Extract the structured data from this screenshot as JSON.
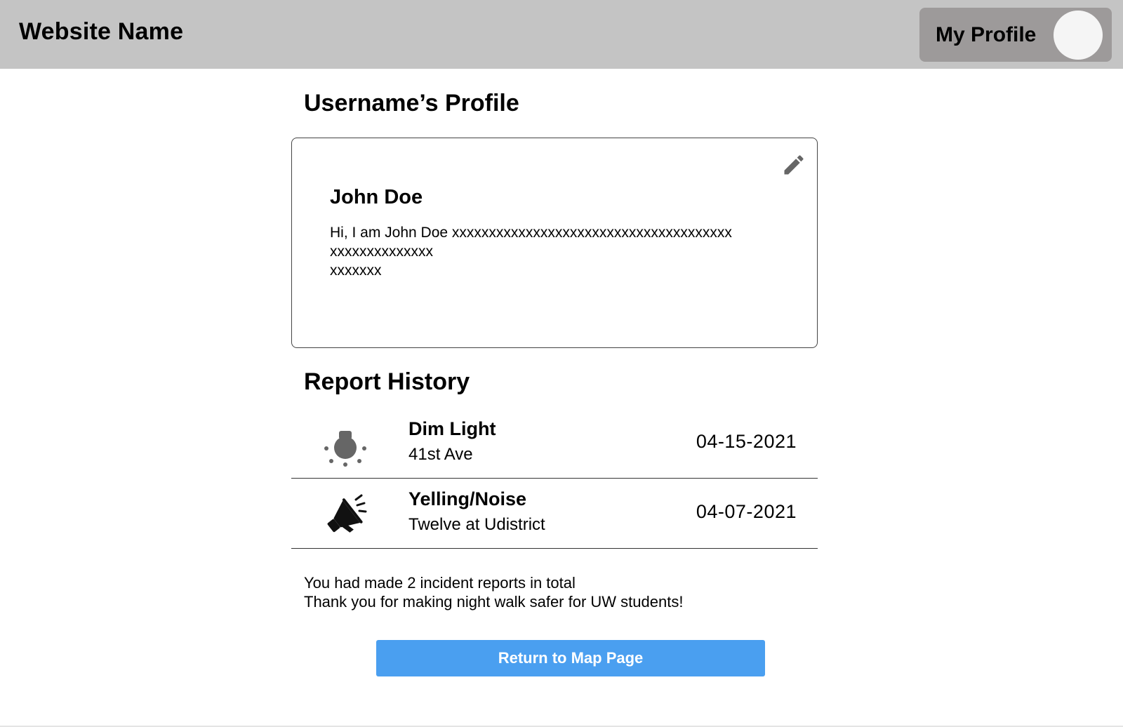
{
  "header": {
    "site_name": "Website Name",
    "profile_label": "My Profile"
  },
  "page": {
    "title": "Username’s Profile"
  },
  "profile_card": {
    "name": "John Doe",
    "bio": "Hi, I am John Doe xxxxxxxxxxxxxxxxxxxxxxxxxxxxxxxxxxxxxx\nxxxxxxxxxxxxxx\nxxxxxxx",
    "edit_icon": "pencil-icon"
  },
  "report_history": {
    "title": "Report History",
    "items": [
      {
        "icon": "lightbulb-icon",
        "title": "Dim Light",
        "location": "41st Ave",
        "date": "04-15-2021"
      },
      {
        "icon": "megaphone-icon",
        "title": "Yelling/Noise",
        "location": "Twelve at Udistrict",
        "date": "04-07-2021"
      }
    ]
  },
  "summary": {
    "line1": "You had made 2 incident reports in total",
    "line2": "Thank you for making night walk safer for UW students!"
  },
  "return_button": {
    "label": "Return to Map Page"
  },
  "colors": {
    "header_bg": "#c4c4c4",
    "profile_button_bg": "#9d9a9a",
    "primary_button": "#4a9ff0"
  }
}
